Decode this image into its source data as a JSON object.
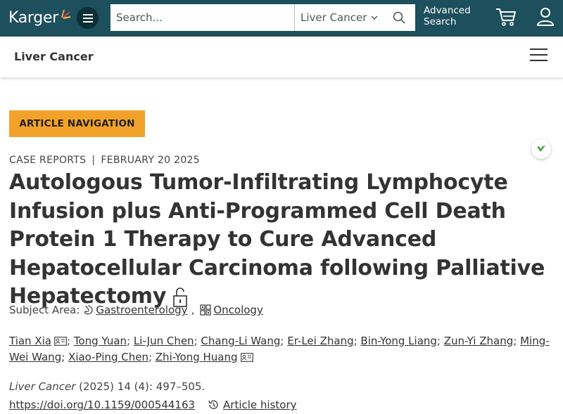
{
  "header": {
    "logo_text": "Karger",
    "search_placeholder": "Search...",
    "search_scope": "Liver Cancer",
    "advanced_search_line1": "Advanced",
    "advanced_search_line2": "Search"
  },
  "journal": {
    "name": "Liver Cancer"
  },
  "article_nav_label": "ARTICLE NAVIGATION",
  "article": {
    "type": "CASE REPORTS",
    "separator": "|",
    "date": "FEBRUARY 20 2025",
    "title": "Autologous Tumor-Infiltrating Lymphocyte Infusion plus Anti-Programmed Cell Death Protein 1 Therapy to Cure Advanced Hepatocellular Carcinoma following Palliative Hepatectomy",
    "subject_label": "Subject Area:",
    "subjects": [
      "Gastroenterology",
      "Oncology"
    ],
    "subject_comma": ",",
    "authors": [
      "Tian Xia",
      "Tong Yuan",
      "Li-Jun Chen",
      "Chang-Li Wang",
      "Er-Lei Zhang",
      "Bin-Yong Liang",
      "Zun-Yi Zhang",
      "Ming-Wei Wang",
      "Xiao-Ping Chen",
      "Zhi-Yong Huang"
    ],
    "journal_italic": "Liver Cancer",
    "citation_rest": " (2025) 14 (4): 497–505.",
    "doi": "https://doi.org/10.1159/000544163",
    "history_label": "Article history"
  },
  "colors": {
    "topbar": "#1d4f5c",
    "accent_button": "#f2a22a",
    "badge_green": "#4caf50"
  }
}
